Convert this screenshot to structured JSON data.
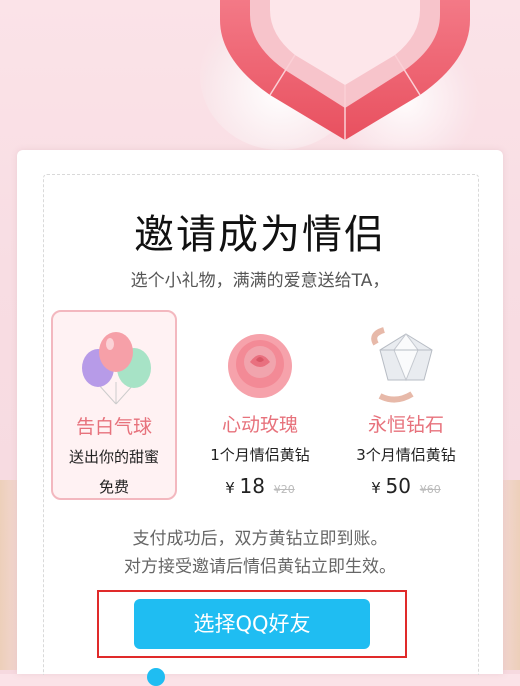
{
  "header": {
    "title": "邀请成为情侣",
    "subtitle": "选个小礼物，满满的爱意送给TA，"
  },
  "gifts": [
    {
      "name": "告白气球",
      "desc": "送出你的甜蜜",
      "price_label": "免费",
      "selected": true,
      "icon": "balloons-icon"
    },
    {
      "name": "心动玫瑰",
      "desc": "1个月情侣黄钻",
      "currency": "¥",
      "price": "18",
      "old_price": "¥20",
      "icon": "rose-icon"
    },
    {
      "name": "永恒钻石",
      "desc": "3个月情侣黄钻",
      "currency": "¥",
      "price": "50",
      "old_price": "¥60",
      "icon": "diamond-ring-icon"
    }
  ],
  "notes": {
    "line1": "支付成功后，双方黄钻立即到账。",
    "line2": "对方接受邀请后情侣黄钻立即生效。"
  },
  "button": {
    "label": "选择QQ好友"
  },
  "colors": {
    "accent": "#1fbdf2",
    "gift_name": "#e7727c",
    "highlight_border": "#e02a2a"
  }
}
